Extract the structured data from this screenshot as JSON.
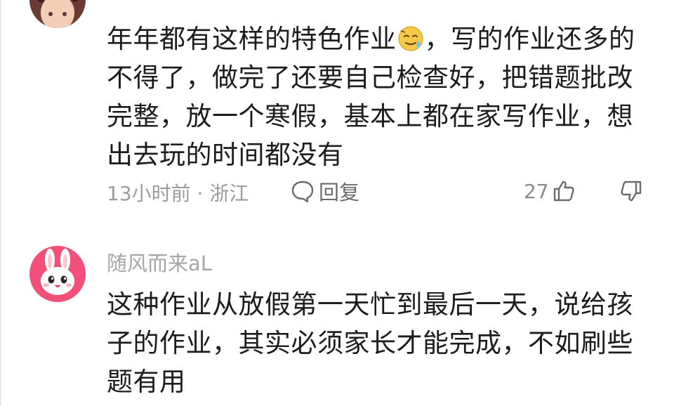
{
  "comments": [
    {
      "username": "",
      "content_before_emoji": "年年都有这样的特色作业",
      "emoji_icon": "sweat-smile-emoji-icon",
      "content_after_emoji": "，写的作业还多的不得了，做完了还要自己检查好，把错题批改完整，放一个寒假，基本上都在家写作业，想出去玩的时间都没有",
      "time_location": "13小时前 · 浙江",
      "reply_label": "回复",
      "like_count": "27"
    },
    {
      "username": "随风而来aL",
      "content": "这种作业从放假第一天忙到最后一天，说给孩子的作业，其实必须家长才能完成，不如刷些题有用",
      "avatar_icon": "pink-bunny-avatar-icon"
    }
  ],
  "colors": {
    "text_primary": "#1c1c1c",
    "text_secondary": "#9b9b9b",
    "username": "#a6a6a6",
    "background": "#ffffff"
  }
}
